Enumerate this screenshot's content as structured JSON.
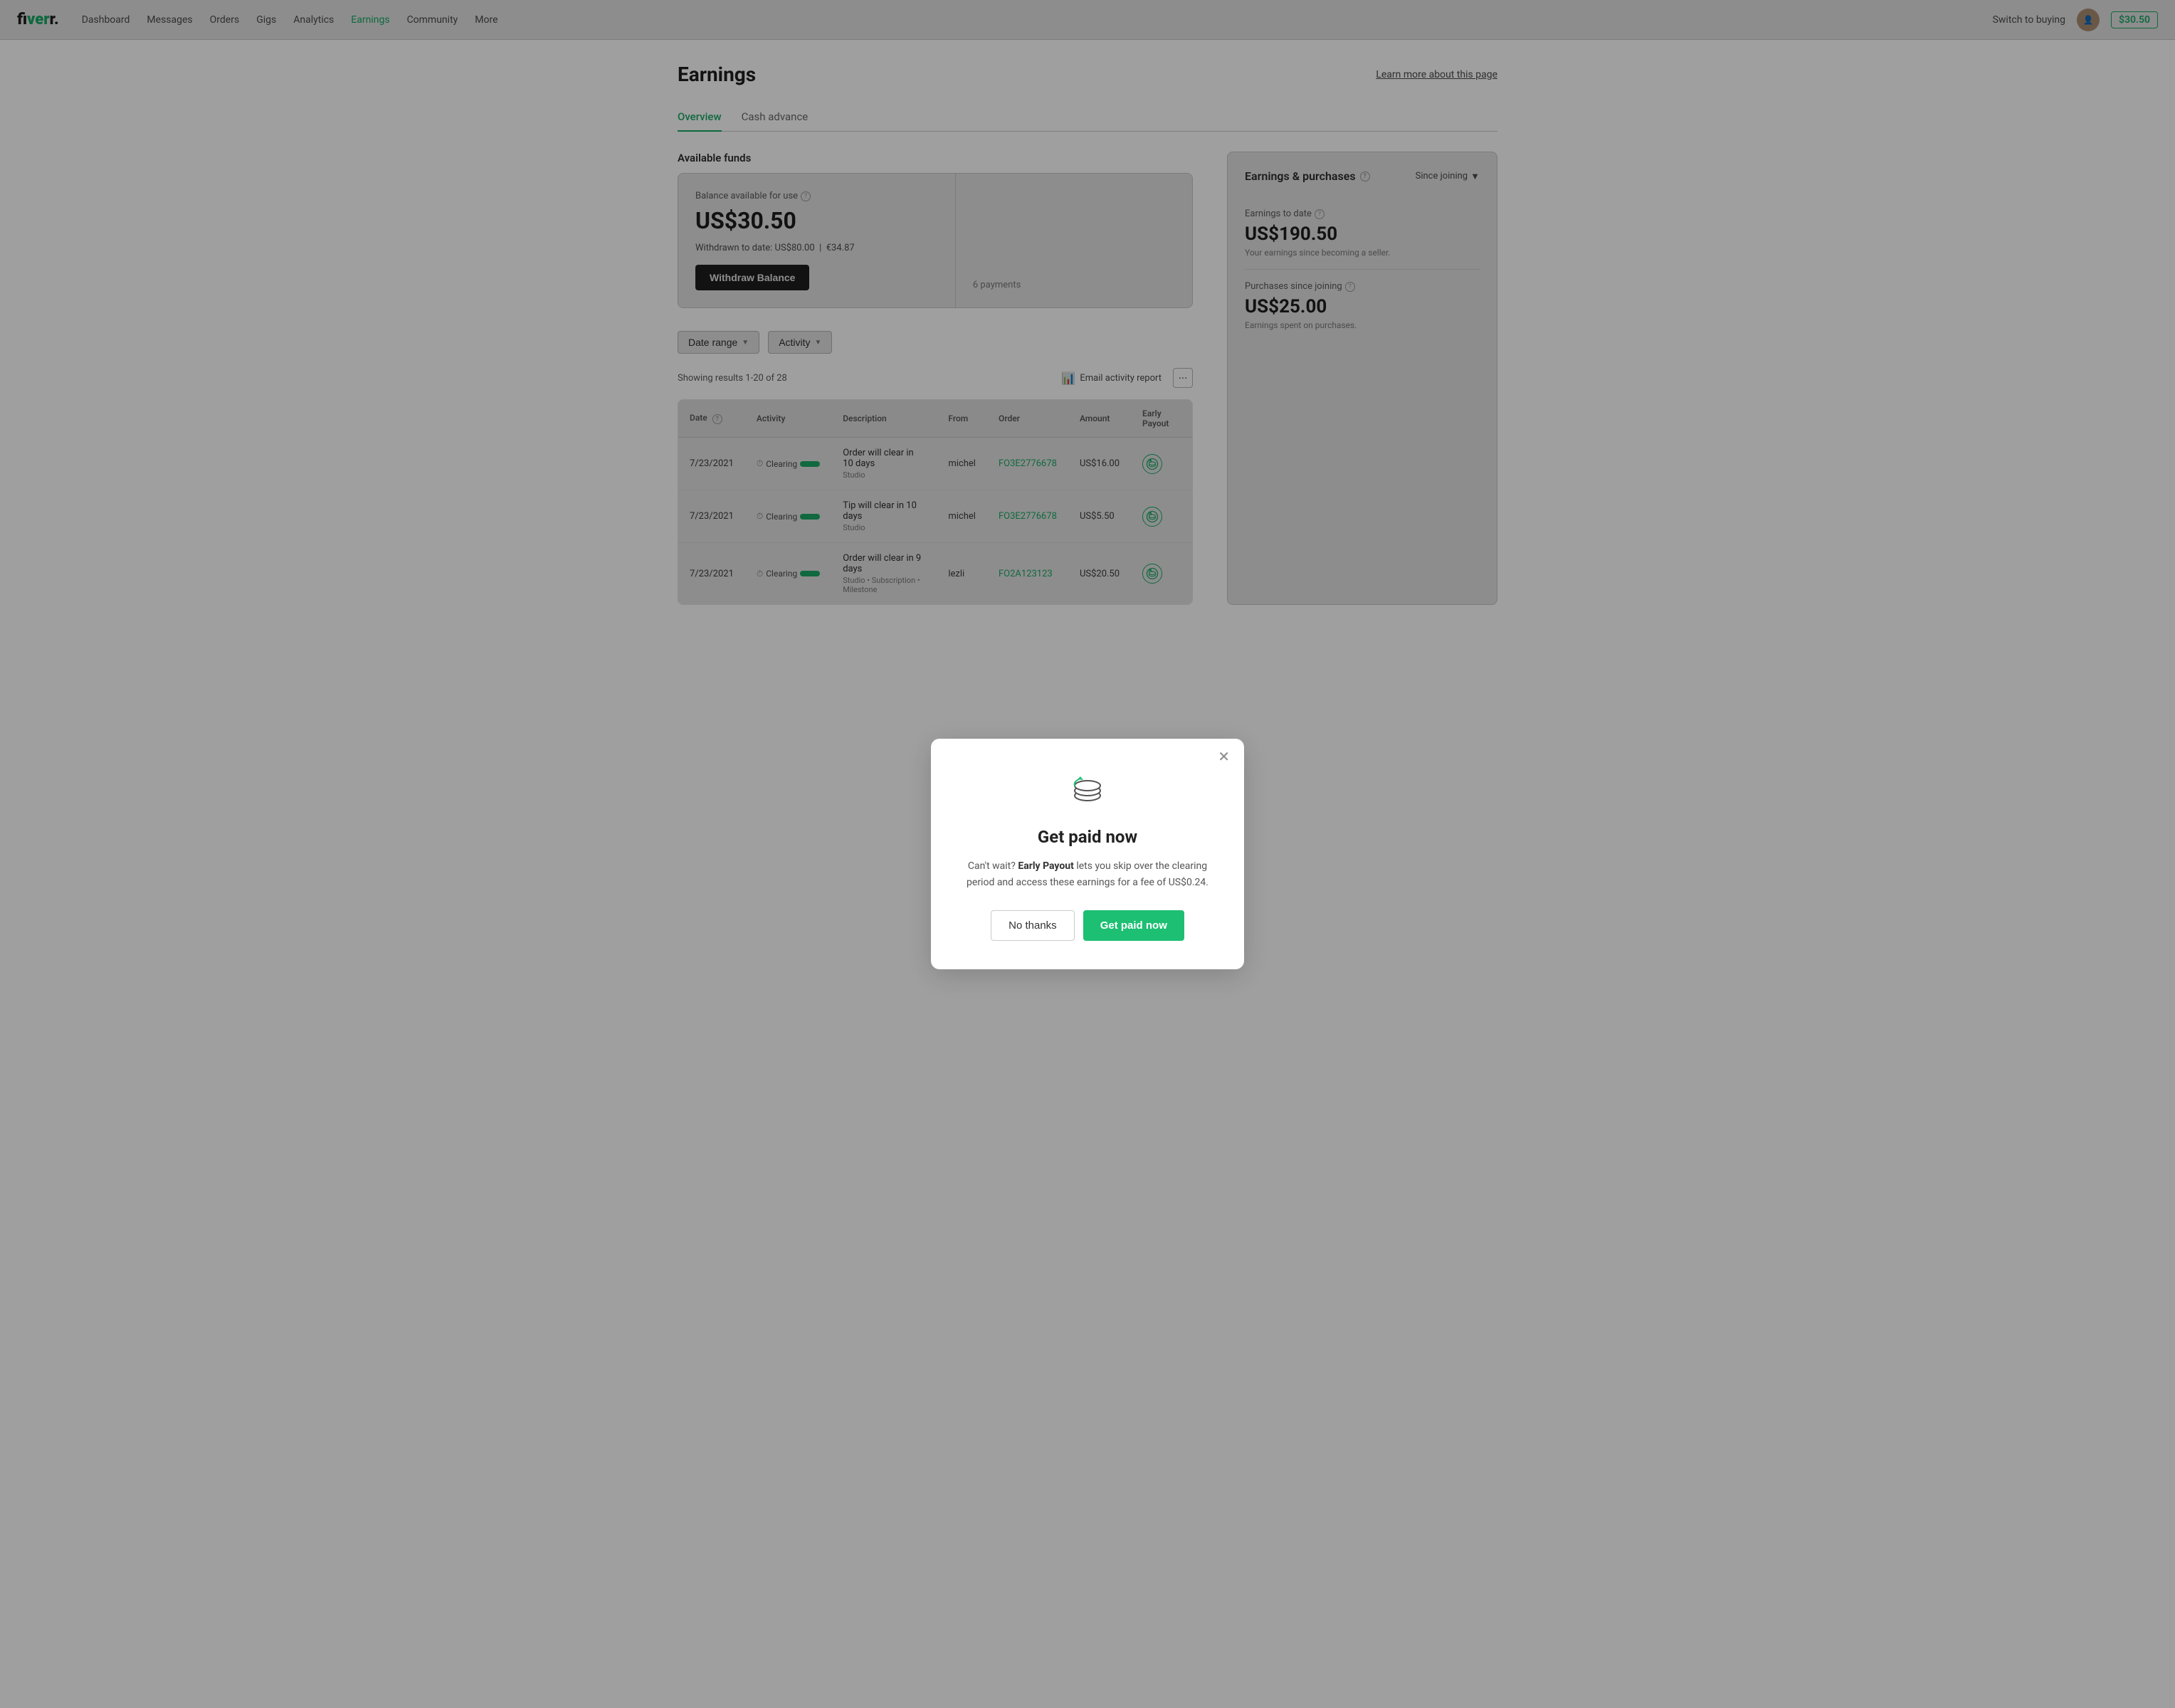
{
  "navbar": {
    "logo": "fiverr.",
    "logo_dot": ".",
    "links": [
      {
        "label": "Dashboard",
        "active": false
      },
      {
        "label": "Messages",
        "active": false
      },
      {
        "label": "Orders",
        "active": false
      },
      {
        "label": "Gigs",
        "active": false
      },
      {
        "label": "Analytics",
        "active": false
      },
      {
        "label": "Earnings",
        "active": true
      },
      {
        "label": "Community",
        "active": false
      },
      {
        "label": "More",
        "active": false
      }
    ],
    "switch_buying": "Switch to buying",
    "balance": "$30.50"
  },
  "page": {
    "title": "Earnings",
    "learn_more": "Learn more about this page"
  },
  "tabs": [
    {
      "label": "Overview",
      "active": true
    },
    {
      "label": "Cash advance",
      "active": false
    }
  ],
  "available_funds": {
    "section_title": "Available funds",
    "card1": {
      "label": "Balance available for use",
      "amount": "US$30.50",
      "withdrawn_label": "Withdrawn to date:",
      "withdrawn_usd": "US$80.00",
      "withdrawn_eur": "€34.87",
      "withdraw_btn": "Withdraw Balance"
    },
    "card2": {
      "payments_count": "6 payments"
    }
  },
  "earnings_purchases": {
    "section_title": "Earnings & purchases",
    "since_joining": "Since joining",
    "earnings_to_date": {
      "label": "Earnings to date",
      "amount": "US$190.50",
      "sub": "Your earnings since becoming a seller."
    },
    "purchases": {
      "label": "Purchases since joining",
      "amount": "US$25.00",
      "sub": "Earnings spent on purchases."
    }
  },
  "filters": {
    "date_range": "Date range",
    "activity": "Activity"
  },
  "results": {
    "showing": "Showing results 1-20 of 28",
    "email_report": "Email activity report",
    "more_btn": "..."
  },
  "table": {
    "headers": [
      "Date",
      "Activity",
      "Description",
      "From",
      "Order",
      "Amount",
      "Early Payout"
    ],
    "rows": [
      {
        "date": "7/23/2021",
        "activity": "Clearing",
        "desc_main": "Order will clear in 10 days",
        "desc_sub": "Studio",
        "from": "michel",
        "order": "FO3E2776678",
        "amount": "US$16.00",
        "early_payout": true
      },
      {
        "date": "7/23/2021",
        "activity": "Clearing",
        "desc_main": "Tip will clear in 10 days",
        "desc_sub": "Studio",
        "from": "michel",
        "order": "FO3E2776678",
        "amount": "US$5.50",
        "early_payout": true
      },
      {
        "date": "7/23/2021",
        "activity": "Clearing",
        "desc_main": "Order will clear in 9 days",
        "desc_sub": "Studio • Subscription • Milestone",
        "from": "lezli",
        "order": "FO2A123123",
        "amount": "US$20.50",
        "early_payout": true
      }
    ]
  },
  "modal": {
    "title": "Get paid now",
    "body_prefix": "Can't wait?",
    "body_bold": "Early Payout",
    "body_suffix": "lets you skip over the clearing period and access these earnings for a fee of US$0.24.",
    "btn_no": "No thanks",
    "btn_yes": "Get paid now",
    "icon": "💰"
  }
}
